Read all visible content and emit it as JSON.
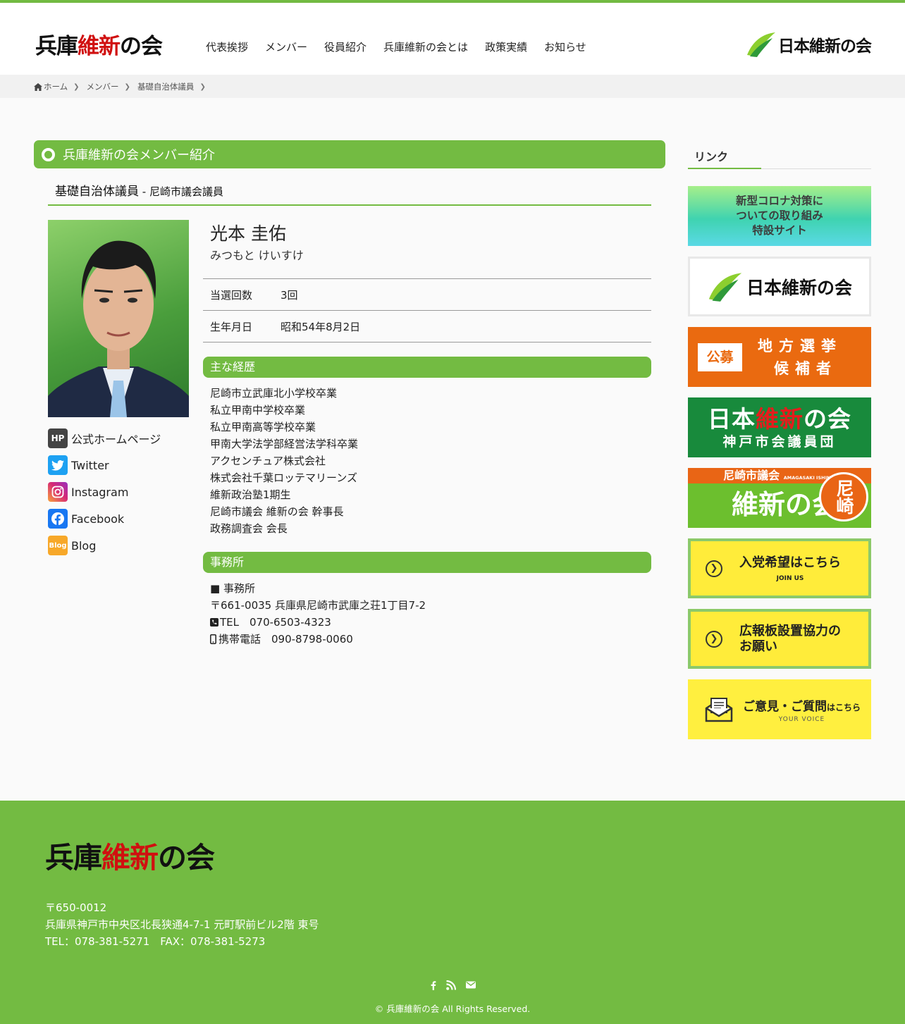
{
  "header": {
    "logo_part1": "兵庫",
    "logo_part2": "維新",
    "logo_part3": "の会",
    "nav": [
      "代表挨拶",
      "メンバー",
      "役員紹介",
      "兵庫維新の会とは",
      "政策実績",
      "お知らせ"
    ],
    "party_logo_text": "日本維新の会"
  },
  "breadcrumb": {
    "home": "ホーム",
    "items": [
      "メンバー",
      "基礎自治体議員"
    ]
  },
  "main": {
    "page_title": "兵庫維新の会メンバー紹介",
    "category": "基礎自治体議員",
    "separator": " - ",
    "assembly": "尼崎市議会議員",
    "name": "光本 圭佑",
    "kana": "みつもと けいすけ",
    "info": [
      {
        "label": "当選回数",
        "value": "3回"
      },
      {
        "label": "生年月日",
        "value": "昭和54年8月2日"
      }
    ],
    "career_title": "主な経歴",
    "career": [
      "尼崎市立武庫北小学校卒業",
      "私立甲南中学校卒業",
      "私立甲南高等学校卒業",
      "甲南大学法学部経営法学科卒業",
      "アクセンチュア株式会社",
      "株式会社千葉ロッテマリーンズ",
      "維新政治塾1期生",
      "尼崎市議会 維新の会 幹事長",
      "政務調査会 会長"
    ],
    "office_title": "事務所",
    "office": {
      "heading": "■ 事務所",
      "address": "〒661-0035 兵庫県尼崎市武庫之荘1丁目7-2",
      "tel": "TEL　070-6503-4323",
      "mobile": "携帯電話　090-8798-0060"
    },
    "sns": [
      {
        "icon": "HP",
        "label": "公式ホームページ",
        "color": "#444444"
      },
      {
        "icon": "twitter-icon",
        "label": "Twitter",
        "color": "#1da1f2"
      },
      {
        "icon": "instagram-icon",
        "label": "Instagram",
        "color": "#d62976"
      },
      {
        "icon": "facebook-icon",
        "label": "Facebook",
        "color": "#1877f2"
      },
      {
        "icon": "Blog",
        "label": "Blog",
        "color": "#f7a829"
      }
    ]
  },
  "sidebar": {
    "title": "リンク",
    "corona": [
      "新型コロナ対策に",
      "ついての取り組み",
      "特設サイト"
    ],
    "ishin": "日本維新の会",
    "koubo_box": "公募",
    "koubo_line1": "地方選挙",
    "koubo_line2": "候補者",
    "kobe_line1_a": "日本",
    "kobe_line1_b": "維新",
    "kobe_line1_c": "の会",
    "kobe_line2": "神戸市会議員団",
    "ama_strip": "尼崎市議会",
    "ama_strip_en": "AMAGASAKI ISHINNOKAI",
    "ama_main": "維新の会",
    "ama_circle": "尼崎",
    "join_big": "入党希望はこちら",
    "join_small": "JOIN US",
    "board_line1": "広報板設置協力の",
    "board_line2": "お願い",
    "voice_big": "ご意見・ご質問",
    "voice_big_small": "はこちら",
    "voice_small": "YOUR VOICE"
  },
  "footer": {
    "logo_part1": "兵庫",
    "logo_part2": "維新",
    "logo_part3": "の会",
    "postal": "〒650-0012",
    "address": "兵庫県神戸市中央区北長狭通4-7-1 元町駅前ビル2階 東号",
    "contact": "TEL：078-381-5271　FAX：078-381-5273",
    "copyright": "© 兵庫維新の会 All Rights Reserved."
  },
  "colors": {
    "accent_green": "#73bb42",
    "logo_red": "#d01010"
  }
}
